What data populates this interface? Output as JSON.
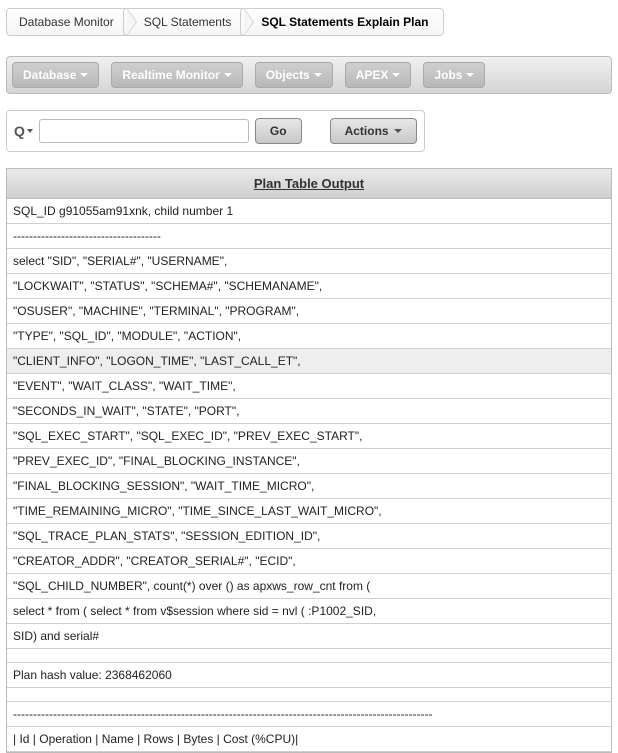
{
  "breadcrumb": {
    "items": [
      {
        "label": "Database Monitor"
      },
      {
        "label": "SQL Statements"
      },
      {
        "label": "SQL Statements Explain Plan"
      }
    ]
  },
  "menu": {
    "items": [
      {
        "label": "Database"
      },
      {
        "label": "Realtime Monitor"
      },
      {
        "label": "Objects"
      },
      {
        "label": "APEX"
      },
      {
        "label": "Jobs"
      }
    ]
  },
  "search": {
    "icon_glyph": "Q",
    "value": "",
    "go_label": "Go",
    "actions_label": "Actions"
  },
  "plan_table": {
    "header": "Plan Table Output",
    "rows": [
      {
        "text": "SQL_ID g91055am91xnk, child number 1",
        "hl": false
      },
      {
        "text": "-------------------------------------",
        "hl": false
      },
      {
        "text": "select \"SID\", \"SERIAL#\", \"USERNAME\",",
        "hl": false
      },
      {
        "text": "\"LOCKWAIT\", \"STATUS\", \"SCHEMA#\", \"SCHEMANAME\",",
        "hl": false
      },
      {
        "text": "\"OSUSER\", \"MACHINE\", \"TERMINAL\", \"PROGRAM\",",
        "hl": false
      },
      {
        "text": "\"TYPE\", \"SQL_ID\", \"MODULE\", \"ACTION\",",
        "hl": false
      },
      {
        "text": "\"CLIENT_INFO\", \"LOGON_TIME\", \"LAST_CALL_ET\",",
        "hl": true
      },
      {
        "text": "\"EVENT\", \"WAIT_CLASS\", \"WAIT_TIME\",",
        "hl": false
      },
      {
        "text": "\"SECONDS_IN_WAIT\", \"STATE\", \"PORT\",",
        "hl": false
      },
      {
        "text": "\"SQL_EXEC_START\", \"SQL_EXEC_ID\", \"PREV_EXEC_START\",",
        "hl": false
      },
      {
        "text": "\"PREV_EXEC_ID\", \"FINAL_BLOCKING_INSTANCE\",",
        "hl": false
      },
      {
        "text": "\"FINAL_BLOCKING_SESSION\", \"WAIT_TIME_MICRO\",",
        "hl": false
      },
      {
        "text": "\"TIME_REMAINING_MICRO\", \"TIME_SINCE_LAST_WAIT_MICRO\",",
        "hl": false
      },
      {
        "text": "\"SQL_TRACE_PLAN_STATS\", \"SESSION_EDITION_ID\",",
        "hl": false
      },
      {
        "text": "\"CREATOR_ADDR\", \"CREATOR_SERIAL#\", \"ECID\",",
        "hl": false
      },
      {
        "text": "\"SQL_CHILD_NUMBER\", count(*) over () as apxws_row_cnt from (",
        "hl": false
      },
      {
        "text": "select * from ( select * from v$session where sid = nvl ( :P1002_SID,",
        "hl": false
      },
      {
        "text": "SID) and serial#",
        "hl": false
      },
      {
        "text": "",
        "hl": false,
        "empty": true
      },
      {
        "text": "Plan hash value: 2368462060",
        "hl": false
      },
      {
        "text": "",
        "hl": false,
        "empty": true
      },
      {
        "text": "---------------------------------------------------------------------------------------------------------",
        "hl": false
      },
      {
        "text": "| Id | Operation | Name | Rows | Bytes | Cost (%CPU)|",
        "hl": false
      }
    ]
  }
}
